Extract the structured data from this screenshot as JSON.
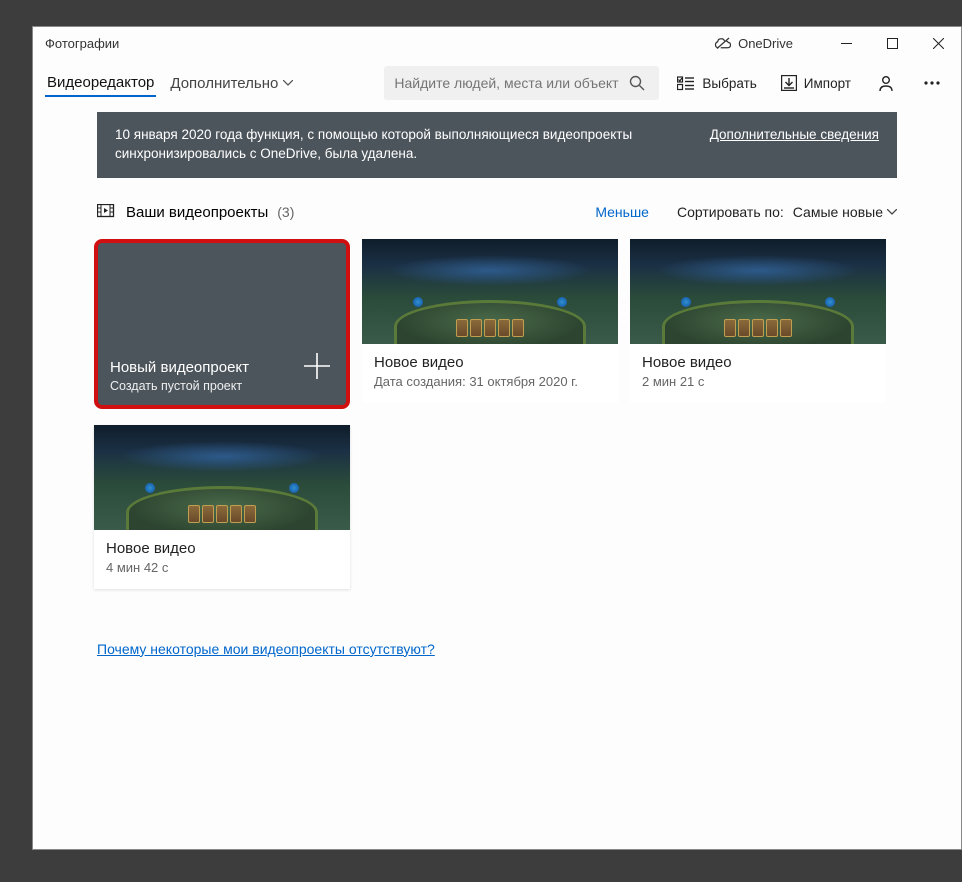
{
  "titlebar": {
    "app_name": "Фотографии",
    "onedrive_label": "OneDrive"
  },
  "header": {
    "tab_video_editor": "Видеоредактор",
    "tab_more": "Дополнительно",
    "search_placeholder": "Найдите людей, места или объект",
    "select_label": "Выбрать",
    "import_label": "Импорт"
  },
  "banner": {
    "text": "10 января 2020 года функция, с помощью которой выполняющиеся видеопроекты синхронизировались с OneDrive, была удалена.",
    "link": "Дополнительные сведения"
  },
  "section": {
    "title": "Ваши видеопроекты",
    "count": "(3)",
    "less": "Меньше",
    "sort_label": "Сортировать по:",
    "sort_value": "Самые новые"
  },
  "new_project": {
    "title": "Новый видеопроект",
    "subtitle": "Создать пустой проект"
  },
  "projects": [
    {
      "title": "Новое видео",
      "sub": "Дата создания: 31 октября 2020 г."
    },
    {
      "title": "Новое видео",
      "sub": "2 мин 21 с"
    },
    {
      "title": "Новое видео",
      "sub": "4 мин 42 с"
    }
  ],
  "missing_link": "Почему некоторые мои видеопроекты отсутствуют?"
}
